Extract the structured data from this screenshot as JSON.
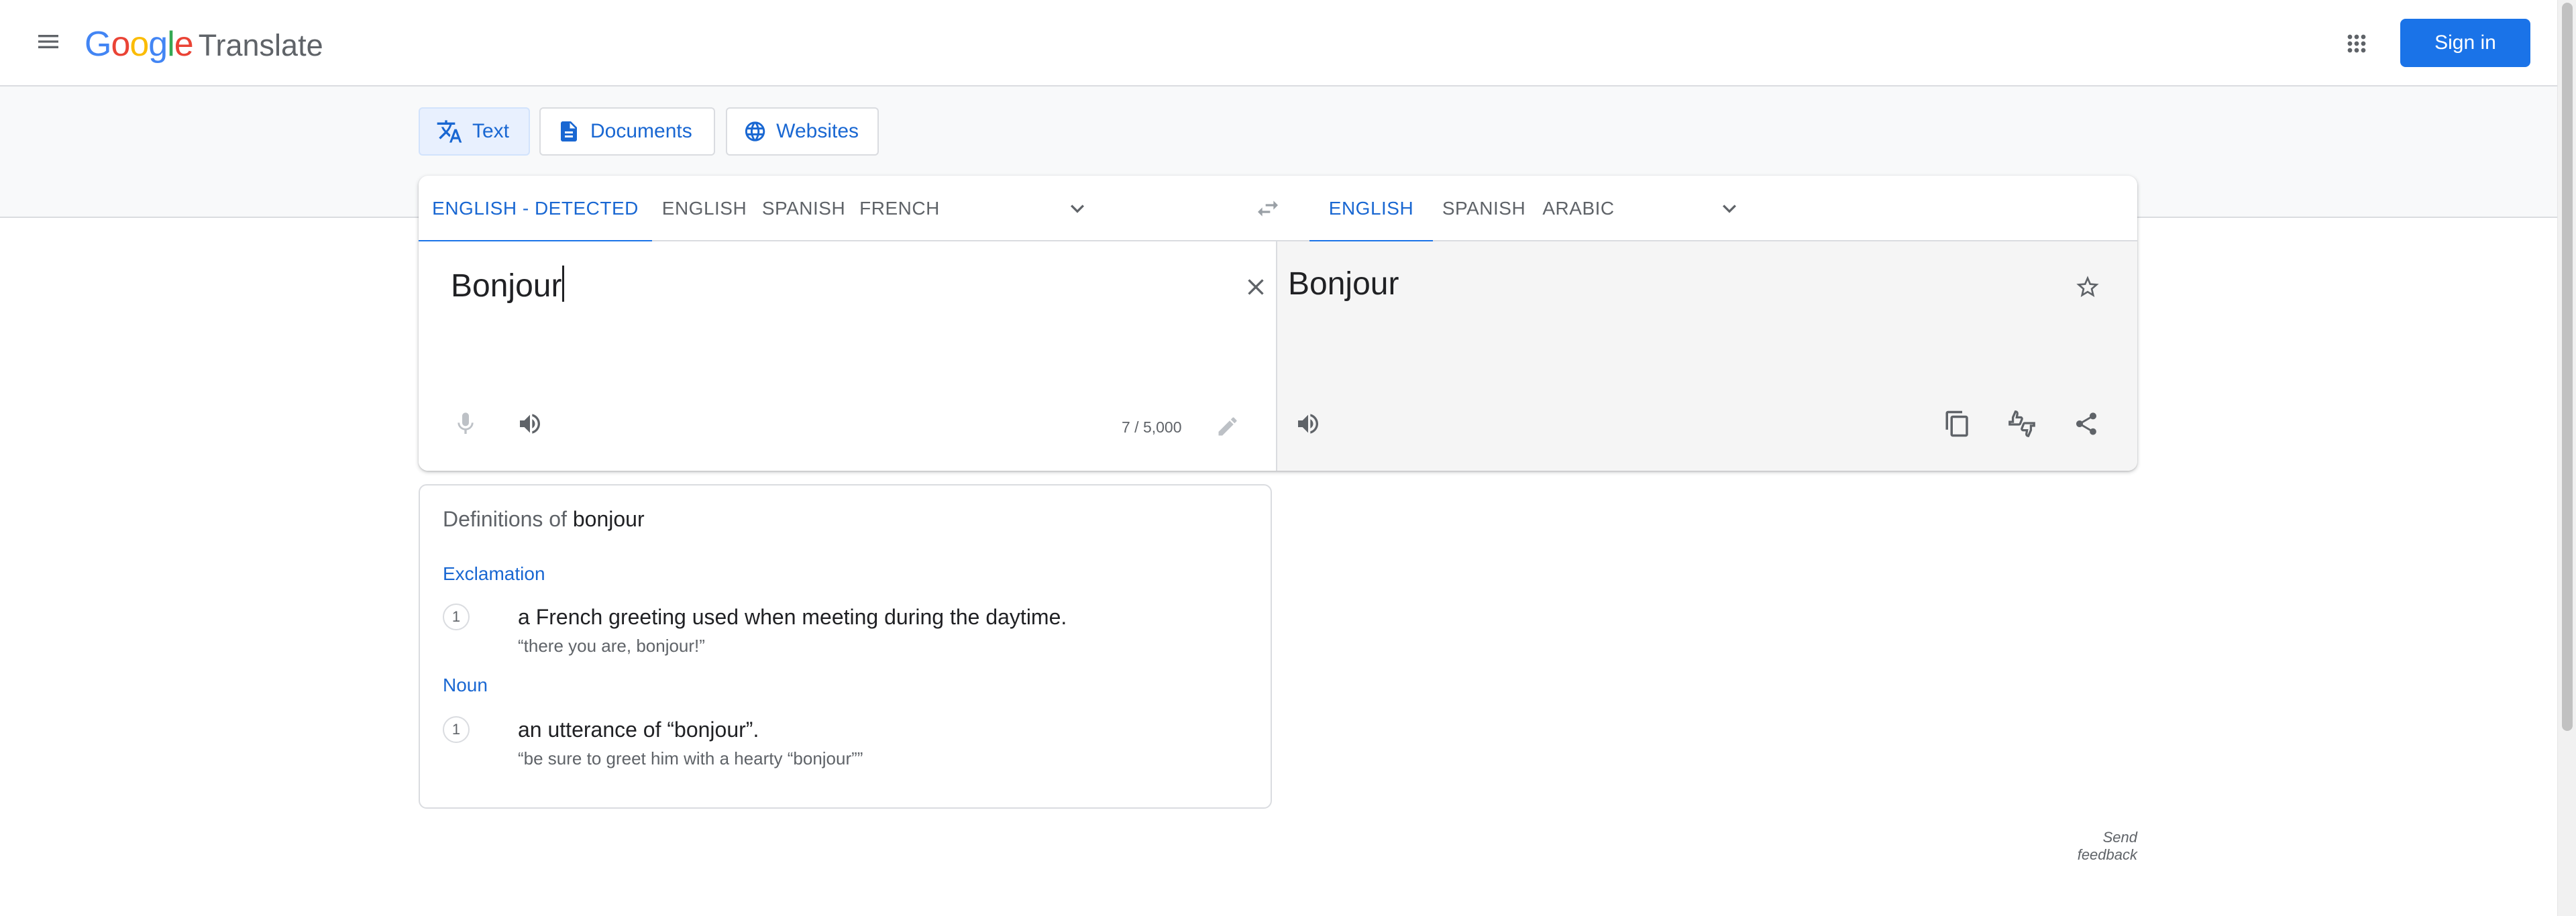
{
  "header": {
    "logo_google": "Google",
    "logo_product": "Translate",
    "signin_label": "Sign in"
  },
  "modes": [
    {
      "label": "Text",
      "active": true
    },
    {
      "label": "Documents",
      "active": false
    },
    {
      "label": "Websites",
      "active": false
    }
  ],
  "source_langs": [
    "ENGLISH - DETECTED",
    "ENGLISH",
    "SPANISH",
    "FRENCH"
  ],
  "target_langs": [
    "ENGLISH",
    "SPANISH",
    "ARABIC"
  ],
  "source": {
    "text": "Bonjour",
    "char_count": "7 / 5,000"
  },
  "target": {
    "text": "Bonjour"
  },
  "definitions": {
    "title_prefix": "Definitions of",
    "word": "bonjour",
    "entries": [
      {
        "pos": "Exclamation",
        "num": "1",
        "gloss": "a French greeting used when meeting during the daytime.",
        "example": "“there you are, bonjour!”"
      },
      {
        "pos": "Noun",
        "num": "1",
        "gloss": "an utterance of “bonjour”.",
        "example": "“be sure to greet him with a hearty “bonjour””"
      }
    ]
  },
  "feedback_label": "Send feedback",
  "colors": {
    "accent": "#1a73e8",
    "accent_text": "#1967d2",
    "icon_grey": "#5f6368"
  }
}
